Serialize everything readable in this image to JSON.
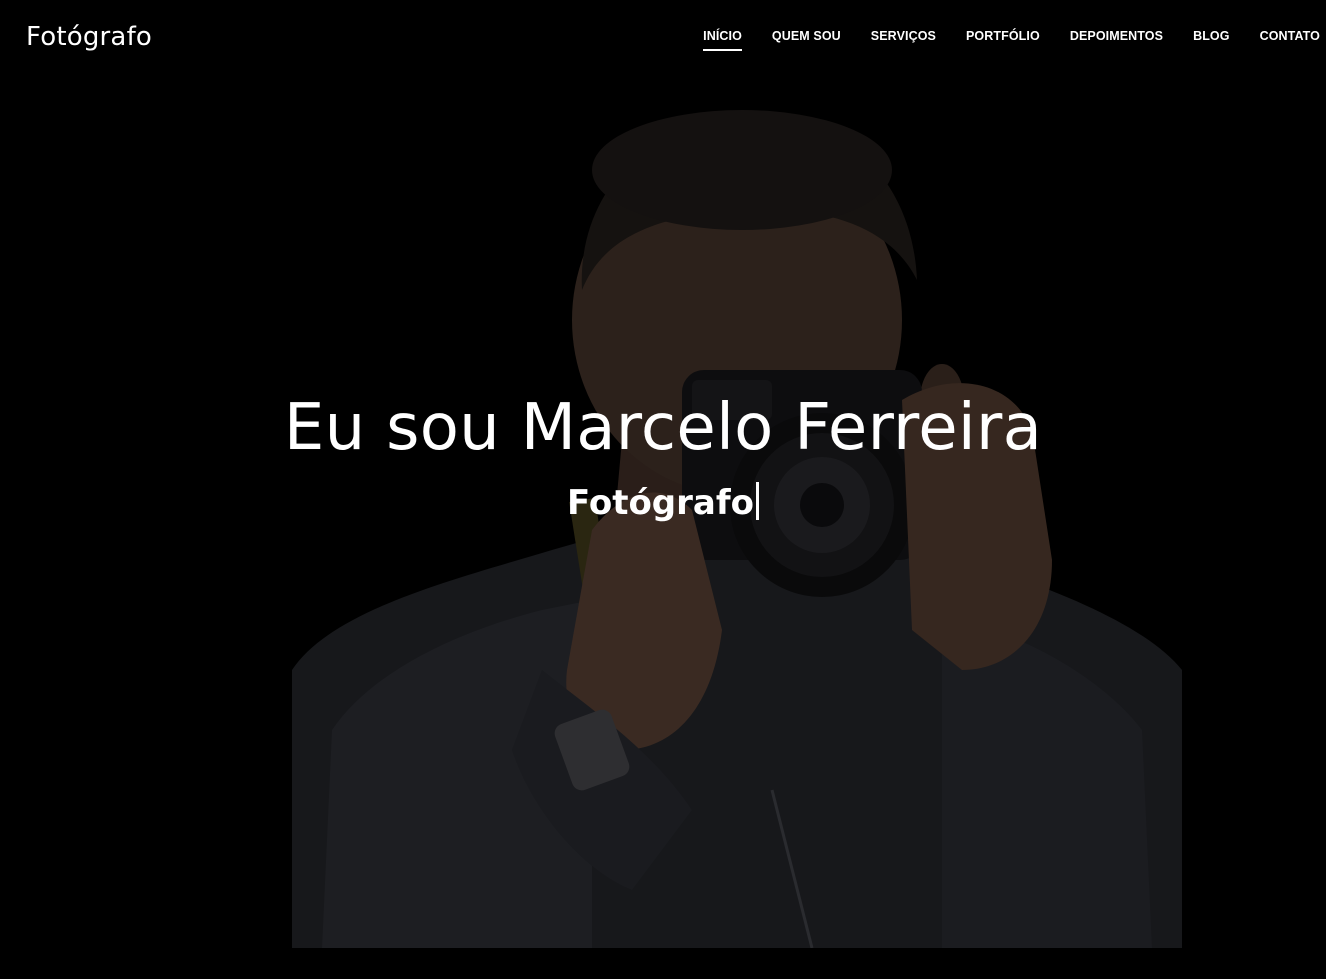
{
  "header": {
    "brand": "Fotógrafo",
    "nav": [
      {
        "label": "INÍCIO",
        "active": true
      },
      {
        "label": "QUEM SOU",
        "active": false
      },
      {
        "label": "SERVIÇOS",
        "active": false
      },
      {
        "label": "PORTFÓLIO",
        "active": false
      },
      {
        "label": "DEPOIMENTOS",
        "active": false
      },
      {
        "label": "BLOG",
        "active": false
      },
      {
        "label": "CONTATO",
        "active": false
      }
    ]
  },
  "hero": {
    "title": "Eu sou Marcelo Ferreira",
    "typed_text": "Fotógrafo"
  },
  "colors": {
    "background": "#000000",
    "text": "#ffffff"
  }
}
